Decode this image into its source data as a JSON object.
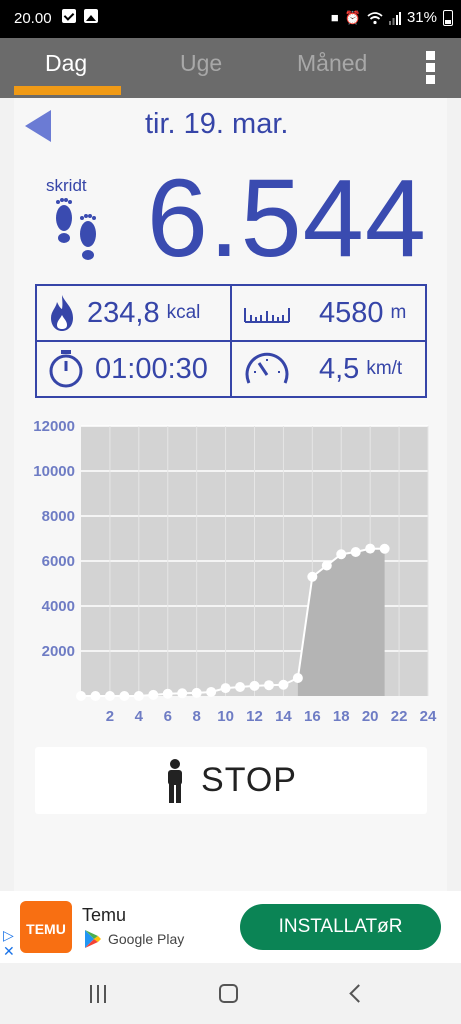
{
  "status_bar": {
    "time": "20.00",
    "battery": "31%",
    "icons": [
      "check-icon",
      "gallery-icon",
      "lock-icon",
      "alarm-icon",
      "wifi-icon",
      "signal-icon",
      "battery-icon"
    ]
  },
  "tabs": [
    {
      "label": "Dag",
      "active": true
    },
    {
      "label": "Uge",
      "active": false
    },
    {
      "label": "Måned",
      "active": false
    }
  ],
  "date": "tir. 19. mar.",
  "steps": {
    "label": "skridt",
    "value": "6.544"
  },
  "stats": {
    "calories": {
      "value": "234,8",
      "unit": "kcal"
    },
    "distance": {
      "value": "4580",
      "unit": "m"
    },
    "duration": {
      "value": "01:00:30"
    },
    "speed": {
      "value": "4,5",
      "unit": "km/t"
    }
  },
  "chart_data": {
    "type": "area",
    "x": [
      0,
      1,
      2,
      3,
      4,
      5,
      6,
      7,
      8,
      9,
      10,
      11,
      12,
      13,
      14,
      15,
      16,
      17,
      18,
      19,
      20,
      21
    ],
    "y": [
      0,
      0,
      0,
      0,
      0,
      50,
      100,
      120,
      140,
      180,
      350,
      400,
      450,
      480,
      500,
      800,
      5300,
      5800,
      6300,
      6400,
      6550,
      6544
    ],
    "xticks": [
      "2",
      "4",
      "6",
      "8",
      "10",
      "12",
      "14",
      "16",
      "18",
      "20",
      "22",
      "24"
    ],
    "yticks": [
      "2000",
      "4000",
      "6000",
      "8000",
      "10000",
      "12000"
    ],
    "xlim": [
      0,
      24
    ],
    "ylim": [
      0,
      12000
    ],
    "grid": true,
    "colors": {
      "plot_bg": "#d3d3d3",
      "fill": "#b4b4b4",
      "line": "#ffffff",
      "tick_label": "#6e7cc4"
    }
  },
  "stop_button": {
    "label": "STOP"
  },
  "ad": {
    "app_name": "Temu",
    "logo_text": "TEMU",
    "store": "Google Play",
    "install_label": "INSTALLATøR"
  },
  "colors": {
    "accent": "#f09a16",
    "primary": "#3645a8",
    "tabbar": "#6b6b6b"
  }
}
